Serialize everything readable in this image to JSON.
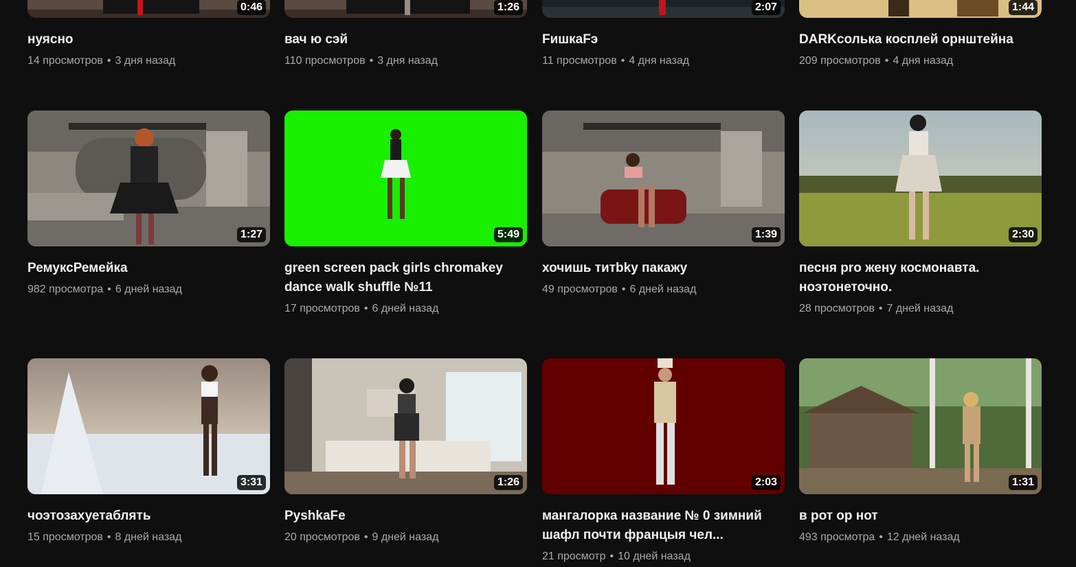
{
  "videos": [
    {
      "title": "нуясно",
      "views": "14 просмотров",
      "age": "3 дня назад",
      "duration": "0:46",
      "thumb": "room-dark"
    },
    {
      "title": "вач ю сэй",
      "views": "110 просмотров",
      "age": "3 дня назад",
      "duration": "1:26",
      "thumb": "room-dark"
    },
    {
      "title": "FишкаFэ",
      "views": "11 просмотров",
      "age": "4 дня назад",
      "duration": "2:07",
      "thumb": "night"
    },
    {
      "title": "DARKсолька косплей орнштейна",
      "views": "209 просмотров",
      "age": "4 дня назад",
      "duration": "1:44",
      "thumb": "sand"
    },
    {
      "title": "РемуксРемейка",
      "views": "982 просмотра",
      "age": "6 дней назад",
      "duration": "1:27",
      "thumb": "sketch-room"
    },
    {
      "title": "green screen pack girls chromakey dance walk shuffle №11",
      "views": "17 просмотров",
      "age": "6 дней назад",
      "duration": "5:49",
      "thumb": "green"
    },
    {
      "title": "хочишь титbky пакажу",
      "views": "49 просмотров",
      "age": "6 дней назад",
      "duration": "1:39",
      "thumb": "sketch-room-sofa"
    },
    {
      "title": "песня pro жену космонавта. ноэтонеточно.",
      "views": "28 просмотров",
      "age": "7 дней назад",
      "duration": "2:30",
      "thumb": "meadow"
    },
    {
      "title": "чоэтозахуетаблять",
      "views": "15 просмотров",
      "age": "8 дней назад",
      "duration": "3:31",
      "thumb": "snow"
    },
    {
      "title": "PyshkaFe",
      "views": "20 просмотров",
      "age": "9 дней назад",
      "duration": "1:26",
      "thumb": "living-room"
    },
    {
      "title": "мангалорка название № 0 зимний шафл почти францыя чел...",
      "views": "21 просмотр",
      "age": "10 дней назад",
      "duration": "2:03",
      "thumb": "red"
    },
    {
      "title": "в рот ор нот",
      "views": "493 просмотра",
      "age": "12 дней назад",
      "duration": "1:31",
      "thumb": "forest-hut"
    }
  ],
  "separator": "•"
}
